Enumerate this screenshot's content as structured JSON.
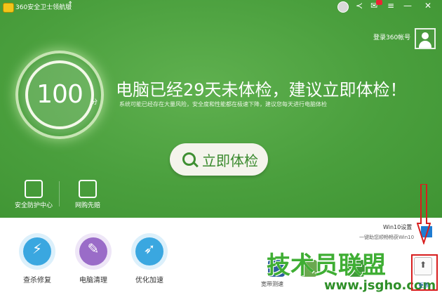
{
  "window": {
    "title": "360安全卫士领航版"
  },
  "header": {
    "login_label": "登录360帐号"
  },
  "score": {
    "value": "100",
    "unit": "分"
  },
  "headline": "电脑已经29天未体检，建议立即体检！",
  "subline": "系统可能已经存在大量风险，安全度和性能都在极速下降，建议您每天进行电脑体检",
  "check_button": {
    "label": "立即体检"
  },
  "features": [
    {
      "label": "安全防护中心",
      "icon": "shield-icon"
    },
    {
      "label": "网购先赔",
      "icon": "cart-icon"
    }
  ],
  "tools": [
    {
      "label": "查杀修复",
      "icon": "lightning-icon",
      "color": "#3aa7e0"
    },
    {
      "label": "电脑清理",
      "icon": "broom-icon",
      "color": "#9a6cc8"
    },
    {
      "label": "优化加速",
      "icon": "rocket-icon",
      "color": "#3aa7e0"
    }
  ],
  "win10": {
    "title": "Win10设置",
    "subtitle": "一键助您顺畅畅获Win10"
  },
  "small_tools": [
    {
      "label": "宽带测速"
    }
  ],
  "more": {
    "label": "更多"
  },
  "watermark": {
    "text": "技术员联盟",
    "url": "www.jsgho.com"
  },
  "colors": {
    "green": "#4a9f3d",
    "highlight_red": "#d81e1e"
  }
}
